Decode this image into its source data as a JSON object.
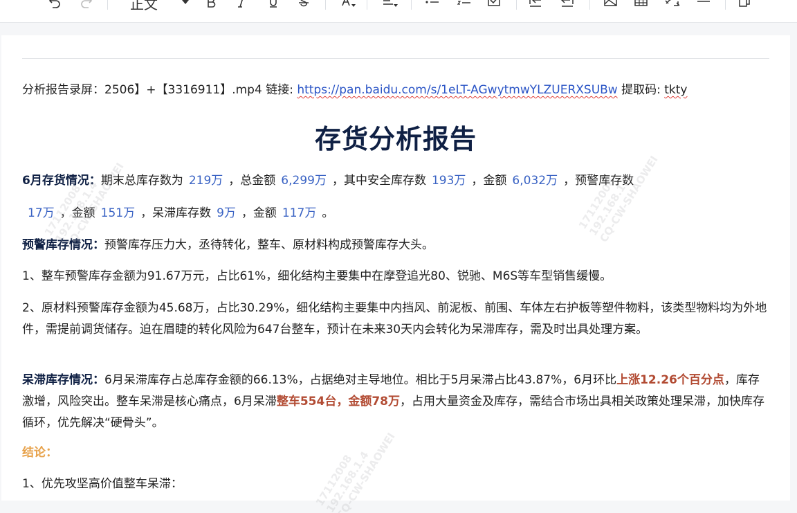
{
  "toolbar": {
    "style_value": "正文",
    "icons": [
      "undo-icon",
      "redo-icon",
      "bold-icon",
      "italic-icon",
      "underline-icon",
      "strikethrough-icon",
      "font-color-icon",
      "align-icon",
      "bulleted-list-icon",
      "numbered-list-icon",
      "checklist-icon",
      "indent-increase-icon",
      "indent-decrease-icon",
      "image-icon",
      "table-icon",
      "link-icon",
      "horizontal-rule-icon",
      "copy-format-icon"
    ]
  },
  "doc": {
    "recording": {
      "prefix": "分析报告录屏：2506】+【3316911】.mp4 链接: ",
      "link": "https://pan.baidu.com/s/1eLT-AGwytmwYLZUERXSUBw",
      "code_label": " 提取码: ",
      "code": "tkty"
    },
    "title": "存货分析报告",
    "june": {
      "label": "6月存货情况：",
      "t1": "期末总库存数为",
      "v1": "219万",
      "t2": "，总金额",
      "v2": "6,299万",
      "t3": "，其中安全库存数",
      "v3": "193万",
      "t4": "，金额",
      "v4": "6,032万",
      "t5": "，预警库存数",
      "v5": "17万",
      "t6": "，金额",
      "v6": "151万",
      "t7": "，呆滞库存数",
      "v7": "9万",
      "t8": "，金额",
      "v8": "117万",
      "t9": "。"
    },
    "warning": {
      "label": "预警库存情况：",
      "text": "预警库存压力大，丞待转化，整车、原材料构成预警库存大头。"
    },
    "item1": "1、整车预警库存金额为91.67万元，占比61%，细化结构主要集中在摩登追光80、锐驰、M6S等车型销售缓慢。",
    "item2": "2、原材料预警库存金额为45.68万，占比30.29%，细化结构主要集中内挡风、前泥板、前围、车体左右护板等塑件物料，该类型物料均为外地件，需提前调货储存。迫在眉睫的转化风险为647台整车，预计在未来30天内会转化为呆滞库存，需及时出具处理方案。",
    "stagnant": {
      "label": "呆滞库存情况：",
      "t1": "6月呆滞库存占总库存金额的66.13%，占据绝对主导地位。相比于5月呆滞占比43.87%，6月环比",
      "r1": "上涨12.26个百分点",
      "t2": "，库存激增，风险突出。整车呆滞是核心痛点，6月呆滞",
      "r2": "整车554台，金额78万",
      "t3": "，占用大量资金及库存，需结合市场出具相关政策处理呆滞，加快库存循环，优先解决“硬骨头”。"
    },
    "conclusion_label": "结论：",
    "conclusion_item1": "1、优先攻坚高价值整车呆滞："
  },
  "watermark": {
    "line1": "17112008",
    "line2": "192.168.1.4",
    "line3": "CQ-CW-SHAOWEI"
  },
  "colors": {
    "title": "#0f2044",
    "value": "#3a63c4",
    "highlight": "#b24b33",
    "conclusion": "#e7a24b",
    "link": "#2b55c6"
  }
}
